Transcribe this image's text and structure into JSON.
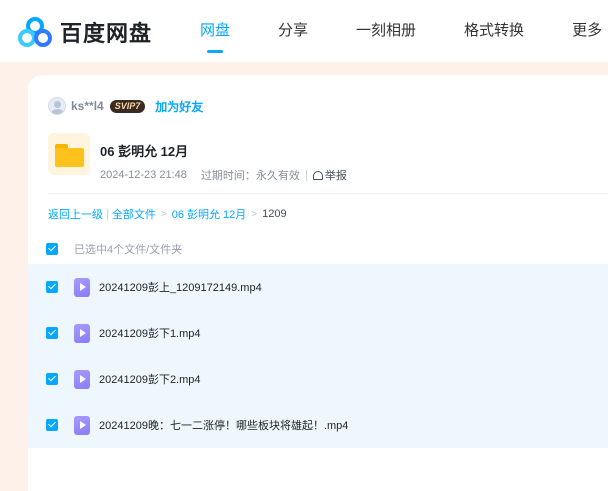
{
  "brand": {
    "name": "百度网盘"
  },
  "nav": {
    "items": [
      {
        "label": "网盘",
        "active": true
      },
      {
        "label": "分享",
        "active": false
      },
      {
        "label": "一刻相册",
        "active": false
      },
      {
        "label": "格式转换",
        "active": false
      },
      {
        "label": "更多",
        "active": false
      }
    ]
  },
  "sharer": {
    "username": "ks**l4",
    "vip_badge": "SVIP7",
    "add_friend_label": "加为好友"
  },
  "share": {
    "title": "06 彭明允 12月",
    "date": "2024-12-23 21:48",
    "expiry": "过期时间：永久有效",
    "report_label": "举报"
  },
  "breadcrumb": {
    "back_label": "返回上一级",
    "all_files_label": "全部文件",
    "folder_label": "06 彭明允 12月",
    "current_label": "1209"
  },
  "selection": {
    "status_text": "已选中4个文件/文件夹"
  },
  "files": [
    {
      "name": "20241209彭上_1209172149.mp4",
      "checked": true
    },
    {
      "name": "20241209彭下1.mp4",
      "checked": true
    },
    {
      "name": "20241209彭下2.mp4",
      "checked": true
    },
    {
      "name": "20241209晚：七一二涨停！哪些板块将雄起！.mp4",
      "checked": true
    }
  ],
  "colors": {
    "accent": "#06a7ff",
    "page_bg": "#fdf1ea",
    "selected_row_bg": "#eef7fe",
    "vip_badge_bg": "#3b2a21",
    "folder": "#ffc21b",
    "video_icon": "#9b8cfb"
  },
  "icons": {
    "logo": "baidu-netdisk-logo",
    "folder": "folder-icon",
    "video": "video-file-icon",
    "report": "report-icon",
    "checkbox": "checkbox-checked-icon"
  }
}
